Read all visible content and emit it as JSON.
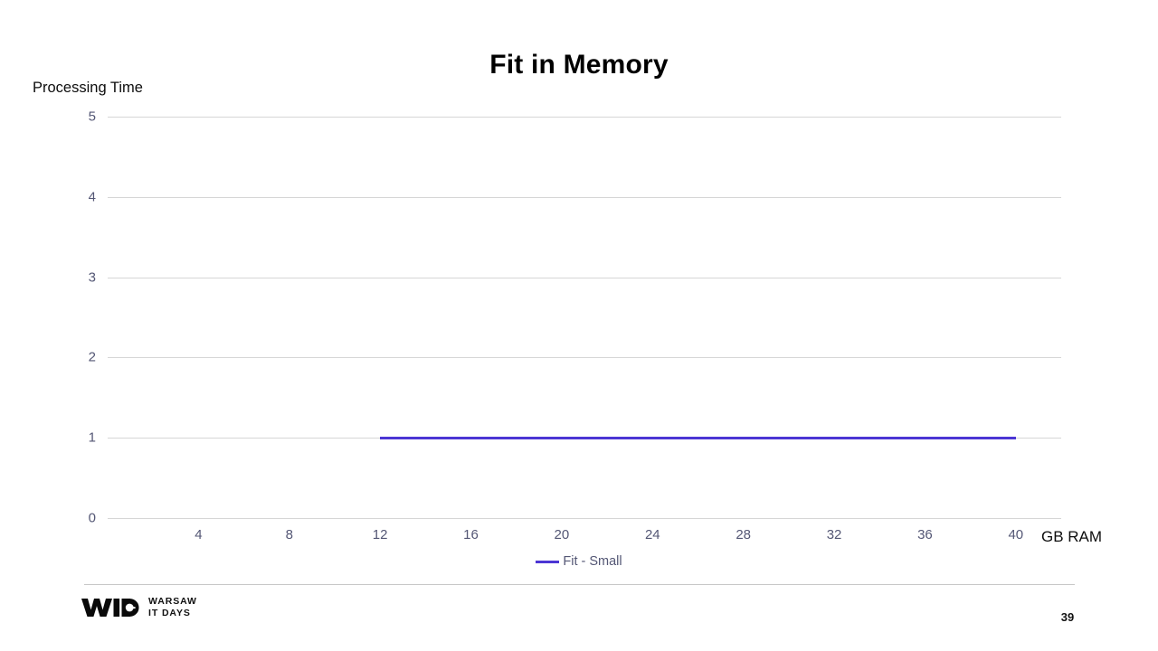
{
  "slide": {
    "title": "Fit in Memory",
    "page_number": "39"
  },
  "footer": {
    "logo_mark": "WID",
    "logo_line1": "WARSAW",
    "logo_line2": "IT DAYS"
  },
  "chart_data": {
    "type": "line",
    "title": "Fit in Memory",
    "xlabel": "GB RAM",
    "ylabel": "Processing Time",
    "xlim": [
      0,
      42
    ],
    "ylim": [
      0,
      5
    ],
    "xticks": [
      4,
      8,
      12,
      16,
      20,
      24,
      28,
      32,
      36,
      40
    ],
    "yticks": [
      0,
      1,
      2,
      3,
      4,
      5
    ],
    "grid": true,
    "legend_position": "bottom",
    "series": [
      {
        "name": "Fit - Small",
        "color": "#4C36D4",
        "x": [
          12,
          16,
          20,
          24,
          28,
          32,
          36,
          40
        ],
        "values": [
          1,
          1,
          1,
          1,
          1,
          1,
          1,
          1
        ]
      }
    ]
  },
  "colors": {
    "series_indigo": "#4C36D4",
    "gridline": "#d6d6d6",
    "tick_label": "#545775",
    "axis_title": "#0d0d0d"
  }
}
